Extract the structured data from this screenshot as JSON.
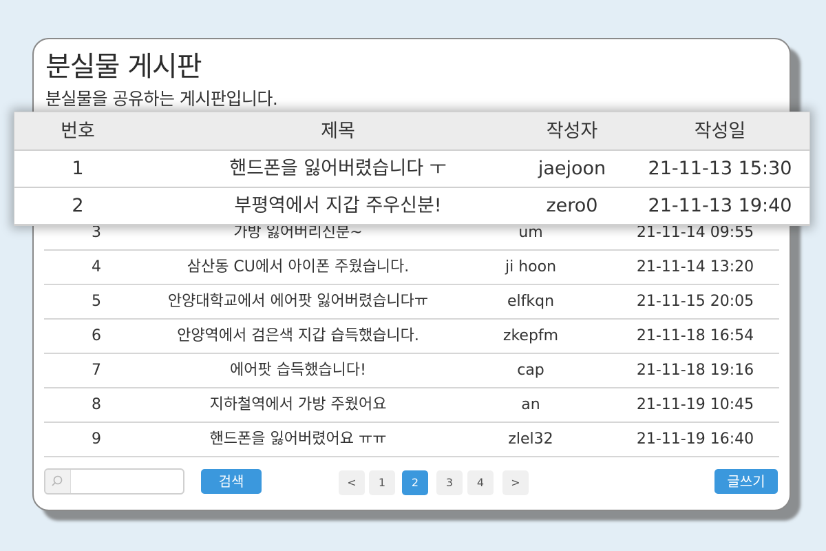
{
  "page": {
    "title": "분실물 게시판",
    "subtitle": "분실물을 공유하는 게시판입니다."
  },
  "columns": {
    "num": "번호",
    "title": "제목",
    "author": "작성자",
    "date": "작성일"
  },
  "overlay_rows": [
    {
      "num": "1",
      "title": "핸드폰을 잃어버렸습니다 ㅜ",
      "author": "jaejoon",
      "date": "21-11-13 15:30"
    },
    {
      "num": "2",
      "title": "부평역에서 지갑 주우신분!",
      "author": "zero0",
      "date": "21-11-13 19:40"
    }
  ],
  "rows": [
    {
      "num": "3",
      "title": "가방 잃어버리신분~",
      "author": "um",
      "date": "21-11-14 09:55"
    },
    {
      "num": "4",
      "title": "삼산동 CU에서 아이폰 주웠습니다.",
      "author": "ji hoon",
      "date": "21-11-14 13:20"
    },
    {
      "num": "5",
      "title": "안양대학교에서 에어팟 잃어버렸습니다ㅠ",
      "author": "elfkqn",
      "date": "21-11-15 20:05"
    },
    {
      "num": "6",
      "title": "안양역에서 검은색 지갑 습득했습니다.",
      "author": "zkepfm",
      "date": "21-11-18 16:54"
    },
    {
      "num": "7",
      "title": "에어팟 습득했습니다!",
      "author": "cap",
      "date": "21-11-18 19:16"
    },
    {
      "num": "8",
      "title": "지하철역에서 가방 주웠어요",
      "author": "an",
      "date": "21-11-19 10:45"
    },
    {
      "num": "9",
      "title": "핸드폰을 잃어버렸어요 ㅠㅠ",
      "author": "zlel32",
      "date": "21-11-19 16:40"
    }
  ],
  "search": {
    "value": "",
    "button_label": "검색"
  },
  "pagination": {
    "prev": "<",
    "next": ">",
    "pages": [
      "1",
      "2",
      "3",
      "4"
    ],
    "current": "2"
  },
  "write_button_label": "글쓰기",
  "colors": {
    "accent": "#3b98dd",
    "background": "#e3eef6",
    "header_row": "#ececec"
  }
}
